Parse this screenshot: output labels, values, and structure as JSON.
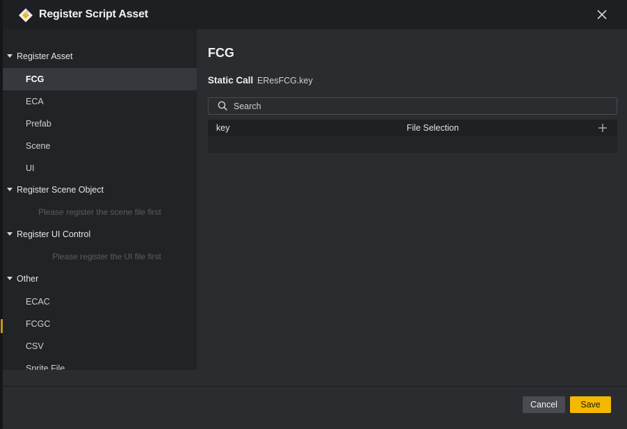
{
  "dialog": {
    "title": "Register Script Asset",
    "icons": {
      "logo": "app-logo-icon",
      "close": "close-icon"
    }
  },
  "sidebar": {
    "groups": [
      {
        "label": "Register Asset",
        "items": [
          {
            "label": "FCG",
            "active": true
          },
          {
            "label": "ECA",
            "active": false
          },
          {
            "label": "Prefab",
            "active": false
          },
          {
            "label": "Scene",
            "active": false
          },
          {
            "label": "UI",
            "active": false
          }
        ]
      },
      {
        "label": "Register Scene Object",
        "hint": "Please register the scene file first"
      },
      {
        "label": "Register UI Control",
        "hint": "Please register the UI file first"
      },
      {
        "label": "Other",
        "items": [
          {
            "label": "ECAC"
          },
          {
            "label": "FCGC"
          },
          {
            "label": "CSV"
          },
          {
            "label": "Sprite File"
          }
        ]
      }
    ]
  },
  "main": {
    "title": "FCG",
    "static_call_label": "Static Call",
    "static_call_value": "EResFCG.key",
    "search": {
      "placeholder": "Search",
      "value": ""
    },
    "table": {
      "columns": [
        "key",
        "File Selection"
      ],
      "add_icon": "plus-icon",
      "rows": []
    }
  },
  "footer": {
    "cancel_label": "Cancel",
    "save_label": "Save"
  },
  "colors": {
    "accent": "#f5b800",
    "title_bar": "#1e1f22",
    "sidebar_bg": "#222326",
    "panel_bg": "#2b2c30",
    "active_item_bg": "#37383d"
  }
}
